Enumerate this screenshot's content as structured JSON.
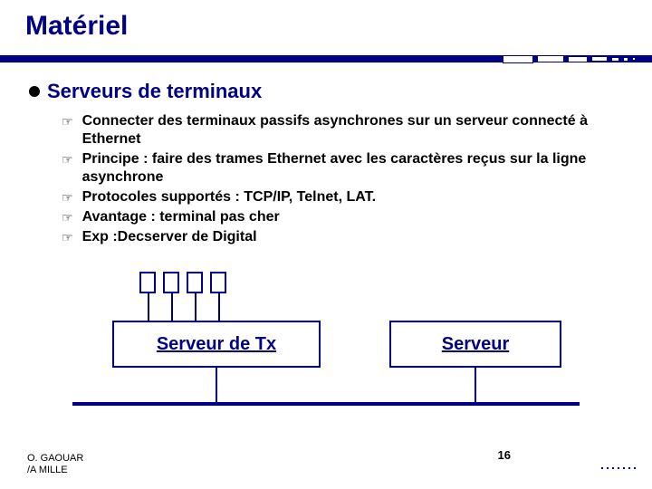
{
  "slide": {
    "title": "Matériel",
    "heading": "Serveurs de terminaux",
    "bullets": [
      "Connecter des terminaux passifs asynchrones sur un serveur connecté à Ethernet",
      "Principe : faire des trames Ethernet avec les caractères reçus sur la ligne asynchrone",
      "Protocoles supportés : TCP/IP, Telnet, LAT.",
      "Avantage : terminal pas cher",
      "Exp :Decserver de Digital"
    ],
    "diagram": {
      "box_tx_label": "Serveur de Tx",
      "box_srv_label": "Serveur"
    },
    "footer": {
      "author1": "O. GAOUAR",
      "author2": "/A MILLE",
      "page": "16"
    }
  }
}
